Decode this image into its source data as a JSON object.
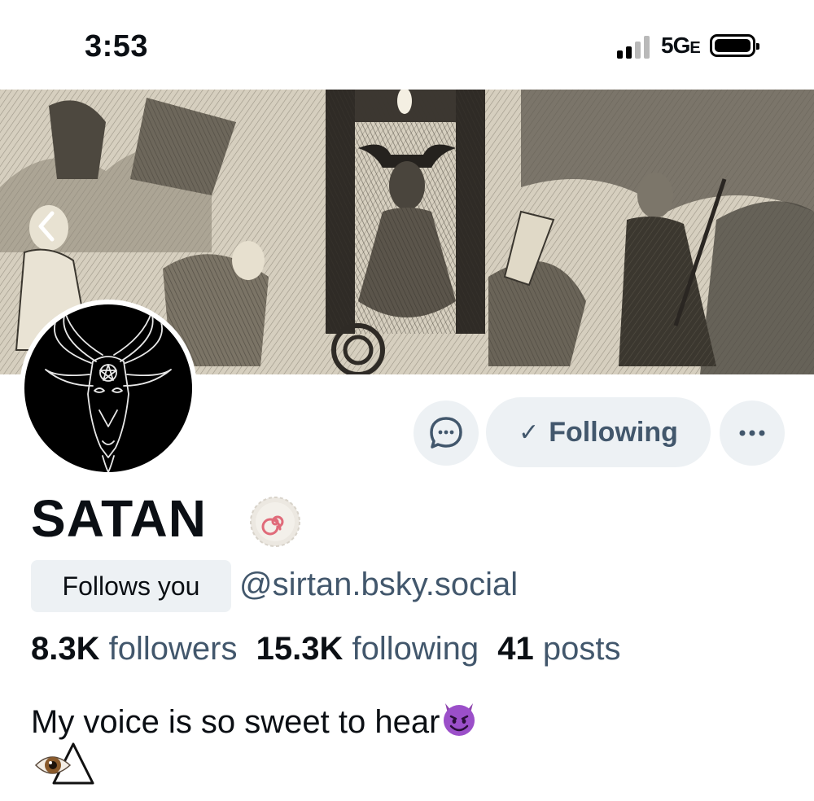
{
  "status_bar": {
    "time": "3:53",
    "network": "5G",
    "network_suffix": "E"
  },
  "profile": {
    "display_name": "SATAN",
    "follows_you_label": "Follows you",
    "handle": "@sirtan.bsky.social",
    "following_button_label": "Following",
    "check_glyph": "✓",
    "stats": {
      "followers_count": "8.3K",
      "followers_label": "followers",
      "following_count": "15.3K",
      "following_label": "following",
      "posts_count": "41",
      "posts_label": "posts"
    },
    "bio_line1": "My voice is so sweet to hear"
  },
  "icons": {
    "back": "chevron-left-icon",
    "message": "chat-bubble-icon",
    "more": "ellipsis-icon",
    "verify": "swirl-badge-icon",
    "bio_emoji_1": "smiling-devil-emoji",
    "bio_emoji_2": "eye-in-triangle-emoji"
  },
  "colors": {
    "button_bg": "#edf1f4",
    "secondary_text": "#42576c",
    "primary_text": "#0b0f14",
    "devil_purple": "#8e44ad"
  }
}
